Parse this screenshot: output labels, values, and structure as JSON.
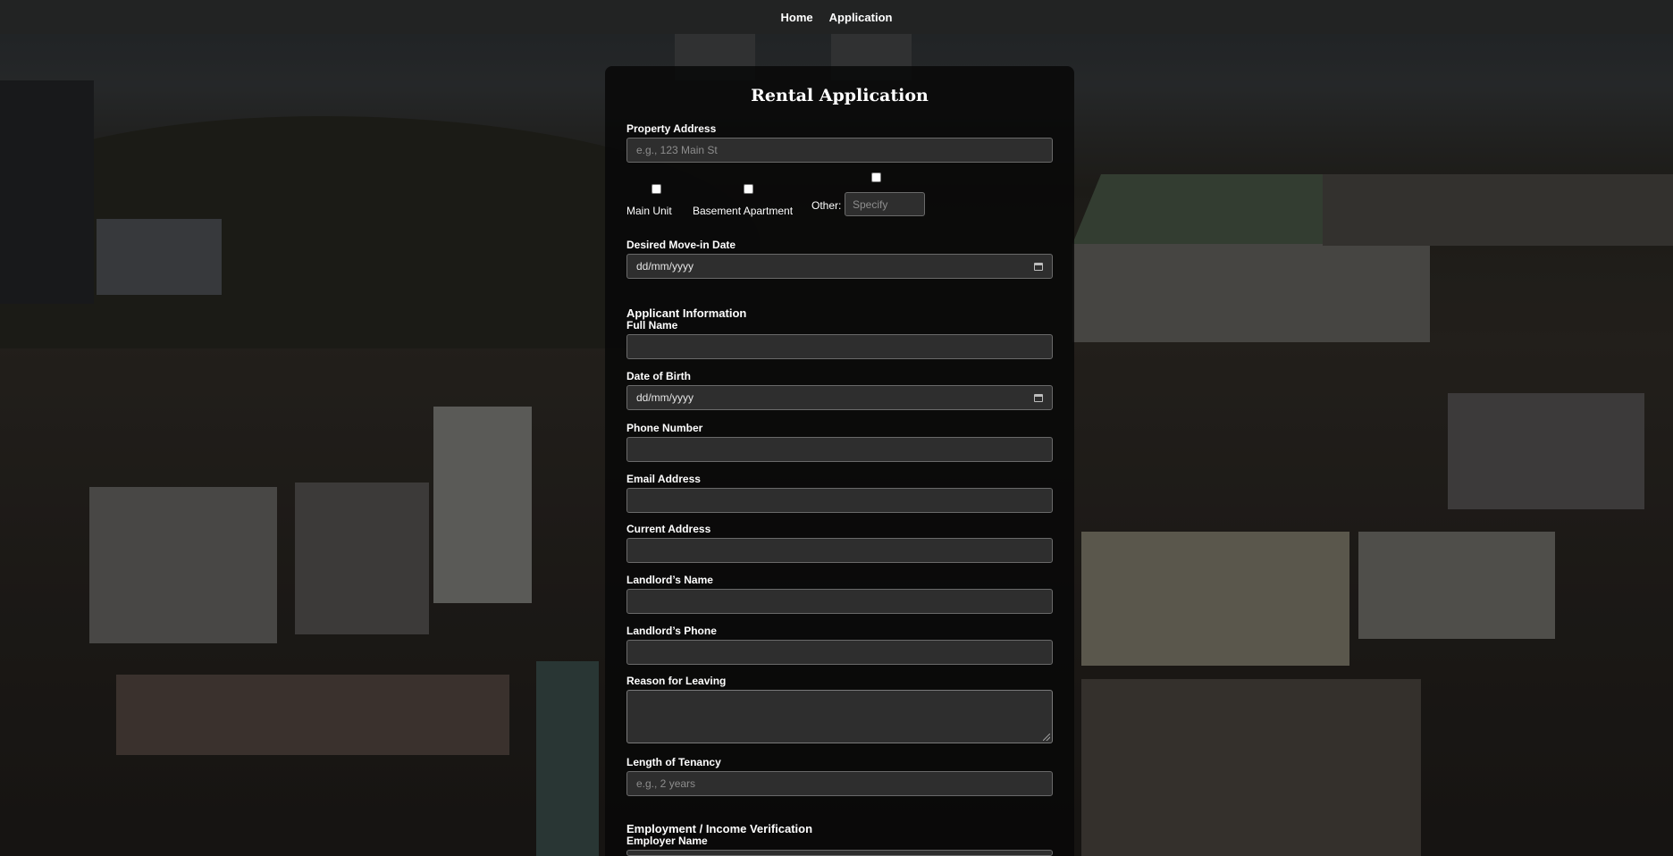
{
  "nav": {
    "home": "Home",
    "application": "Application"
  },
  "form": {
    "title": "Rental Application",
    "property_address": {
      "label": "Property Address",
      "placeholder": "e.g., 123 Main St"
    },
    "unit_options": {
      "main_unit": "Main Unit",
      "basement_apartment": "Basement Apartment",
      "other": "Other:",
      "other_placeholder": "Specify"
    },
    "move_in": {
      "label": "Desired Move-in Date",
      "value": "dd/mm/yyyy"
    },
    "applicant_section": "Applicant Information",
    "full_name": {
      "label": "Full Name",
      "value": ""
    },
    "date_of_birth": {
      "label": "Date of Birth",
      "value": "dd/mm/yyyy"
    },
    "phone": {
      "label": "Phone Number",
      "value": ""
    },
    "email": {
      "label": "Email Address",
      "value": ""
    },
    "current_address": {
      "label": "Current Address",
      "value": ""
    },
    "landlord_name": {
      "label": "Landlord’s Name",
      "value": ""
    },
    "landlord_phone": {
      "label": "Landlord’s Phone",
      "value": ""
    },
    "reason_for_leaving": {
      "label": "Reason for Leaving",
      "value": ""
    },
    "tenancy_length": {
      "label": "Length of Tenancy",
      "placeholder": "e.g., 2 years"
    },
    "employment_section": "Employment / Income Verification",
    "employer_name": {
      "label": "Employer Name",
      "value": ""
    }
  },
  "colors": {
    "nav_bg": "#222323",
    "card_bg": "#080808",
    "input_bg": "#2e2e2e",
    "input_border": "#6a6a6a",
    "text": "#ffffff"
  }
}
